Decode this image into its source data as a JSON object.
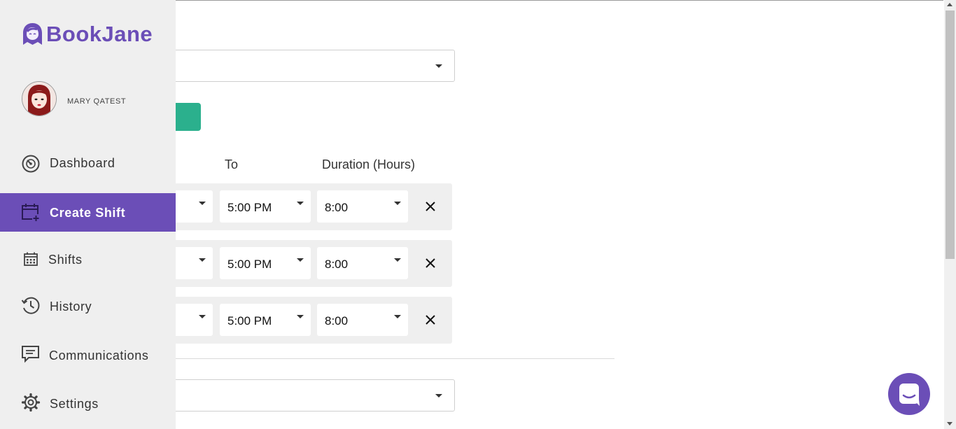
{
  "app": {
    "logo_text": "BookJane",
    "brand_color": "#6b4eb7",
    "accent_green": "#2bb08d"
  },
  "user": {
    "name": "MARY QATEST"
  },
  "sidebar": {
    "items": [
      {
        "label": "Dashboard",
        "icon": "dashboard-gauge-icon",
        "active": false
      },
      {
        "label": "Create Shift",
        "icon": "calendar-add-icon",
        "active": true
      },
      {
        "label": "Shifts",
        "icon": "calendar-icon",
        "active": false
      },
      {
        "label": "History",
        "icon": "history-clock-icon",
        "active": false
      },
      {
        "label": "Communications",
        "icon": "message-icon",
        "active": false
      },
      {
        "label": "Settings",
        "icon": "gear-icon",
        "active": false
      }
    ]
  },
  "form": {
    "columns": {
      "to": "To",
      "duration": "Duration (Hours)"
    },
    "rows": [
      {
        "to": "5:00 PM",
        "duration": "8:00"
      },
      {
        "to": "5:00 PM",
        "duration": "8:00"
      },
      {
        "to": "5:00 PM",
        "duration": "8:00"
      }
    ]
  }
}
